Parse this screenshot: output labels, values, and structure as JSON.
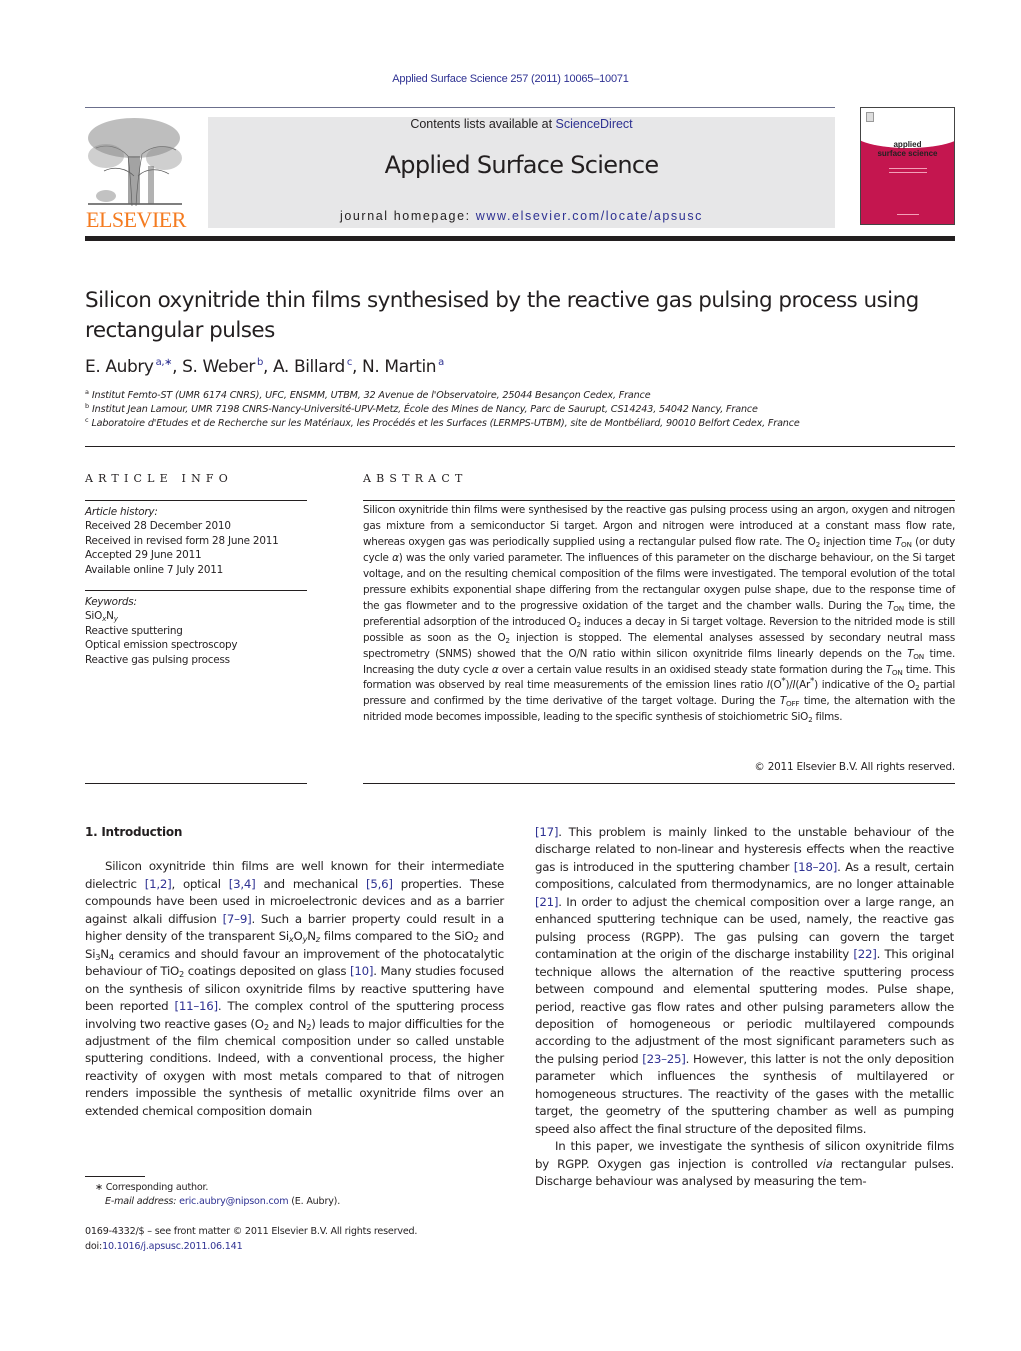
{
  "header": {
    "citation": "Applied Surface Science 257 (2011) 10065–10071",
    "contents_prefix": "Contents lists available at ",
    "contents_link": "ScienceDirect",
    "journal_title": "Applied Surface Science",
    "homepage_prefix": "journal homepage: ",
    "homepage_link": "www.elsevier.com/locate/apsusc",
    "publisher_logo_text": "ELSEVIER",
    "cover_title_line1": "applied",
    "cover_title_line2": "surface science",
    "colors": {
      "publisher_orange": "#f47b20",
      "cover_magenta": "#c4164f",
      "link_blue": "#2e3192"
    }
  },
  "paper": {
    "title": "Silicon oxynitride thin films synthesised by the reactive gas pulsing process using rectangular pulses",
    "authors": [
      {
        "name": "E. Aubry",
        "sup": "a,∗"
      },
      {
        "name": "S. Weber",
        "sup": "b"
      },
      {
        "name": "A. Billard",
        "sup": "c"
      },
      {
        "name": "N. Martin",
        "sup": "a"
      }
    ],
    "affiliations": [
      {
        "key": "a",
        "text": "Institut Femto-ST (UMR 6174 CNRS), UFC, ENSMM, UTBM, 32 Avenue de l'Observatoire, 25044 Besançon Cedex, France"
      },
      {
        "key": "b",
        "text": "Institut Jean Lamour, UMR 7198 CNRS-Nancy-Université-UPV-Metz, École des Mines de Nancy, Parc de Saurupt, CS14243, 54042 Nancy, France"
      },
      {
        "key": "c",
        "text": "Laboratoire d'Etudes et de Recherche sur les Matériaux, les Procédés et les Surfaces (LERMPS-UTBM), site de Montbéliard, 90010 Belfort Cedex, France"
      }
    ]
  },
  "article_info": {
    "heading": "ARTICLE INFO",
    "history_label": "Article history:",
    "history": [
      "Received 28 December 2010",
      "Received in revised form 28 June 2011",
      "Accepted 29 June 2011",
      "Available online 7 July 2011"
    ],
    "keywords_label": "Keywords:",
    "keywords": [
      "SiOxNy",
      "Reactive sputtering",
      "Optical emission spectroscopy",
      "Reactive gas pulsing process"
    ]
  },
  "abstract": {
    "heading": "ABSTRACT",
    "text": "Silicon oxynitride thin films were synthesised by the reactive gas pulsing process using an argon, oxygen and nitrogen gas mixture from a semiconductor Si target. Argon and nitrogen were introduced at a constant mass flow rate, whereas oxygen gas was periodically supplied using a rectangular pulsed flow rate. The O2 injection time TON (or duty cycle α) was the only varied parameter. The influences of this parameter on the discharge behaviour, on the Si target voltage, and on the resulting chemical composition of the films were investigated. The temporal evolution of the total pressure exhibits exponential shape differing from the rectangular oxygen pulse shape, due to the response time of the gas flowmeter and to the progressive oxidation of the target and the chamber walls. During the TON time, the preferential adsorption of the introduced O2 induces a decay in Si target voltage. Reversion to the nitrided mode is still possible as soon as the O2 injection is stopped. The elemental analyses assessed by secondary neutral mass spectrometry (SNMS) showed that the O/N ratio within silicon oxynitride films linearly depends on the TON time. Increasing the duty cycle α over a certain value results in an oxidised steady state formation during the TON time. This formation was observed by real time measurements of the emission lines ratio I(O*)/I(Ar*) indicative of the O2 partial pressure and confirmed by the time derivative of the target voltage. During the TOFF time, the alternation with the nitrided mode becomes impossible, leading to the specific synthesis of stoichiometric SiO2 films.",
    "copyright": "© 2011 Elsevier B.V. All rights reserved."
  },
  "body": {
    "section_heading": "1.  Introduction",
    "left_column": "Silicon oxynitride thin films are well known for their intermediate dielectric [1,2], optical [3,4] and mechanical [5,6] properties. These compounds have been used in microelectronic devices and as a barrier against alkali diffusion [7–9]. Such a barrier property could result in a higher density of the transparent SixOyNz films compared to the SiO2 and Si3N4 ceramics and should favour an improvement of the photocatalytic behaviour of TiO2 coatings deposited on glass [10]. Many studies focused on the synthesis of silicon oxynitride films by reactive sputtering have been reported [11–16]. The complex control of the sputtering process involving two reactive gases (O2 and N2) leads to major difficulties for the adjustment of the film chemical composition under so called unstable sputtering conditions. Indeed, with a conventional process, the higher reactivity of oxygen with most metals compared to that of nitrogen renders impossible the synthesis of metallic oxynitride films over an extended chemical composition domain",
    "right_column_p1": "[17]. This problem is mainly linked to the unstable behaviour of the discharge related to non-linear and hysteresis effects when the reactive gas is introduced in the sputtering chamber [18–20]. As a result, certain compositions, calculated from thermodynamics, are no longer attainable [21]. In order to adjust the chemical composition over a large range, an enhanced sputtering technique can be used, namely, the reactive gas pulsing process (RGPP). The gas pulsing can govern the target contamination at the origin of the discharge instability [22]. This original technique allows the alternation of the reactive sputtering process between compound and elemental sputtering modes. Pulse shape, period, reactive gas flow rates and other pulsing parameters allow the deposition of homogeneous or periodic multilayered compounds according to the adjustment of the most significant parameters such as the pulsing period [23–25]. However, this latter is not the only deposition parameter which influences the synthesis of multilayered or homogeneous structures. The reactivity of the gases with the metallic target, the geometry of the sputtering chamber as well as pumping speed also affect the final structure of the deposited films.",
    "right_column_p2": "In this paper, we investigate the synthesis of silicon oxynitride films by RGPP. Oxygen gas injection is controlled via rectangular pulses. Discharge behaviour was analysed by measuring the tem-"
  },
  "footnotes": {
    "corresponding": "∗  Corresponding author.",
    "email_label": "E-mail address: ",
    "email": "eric.aubry@nipson.com",
    "email_suffix": " (E. Aubry).",
    "issn_line": "0169-4332/$ – see front matter © 2011 Elsevier B.V. All rights reserved.",
    "doi_prefix": "doi:",
    "doi": "10.1016/j.apsusc.2011.06.141"
  }
}
